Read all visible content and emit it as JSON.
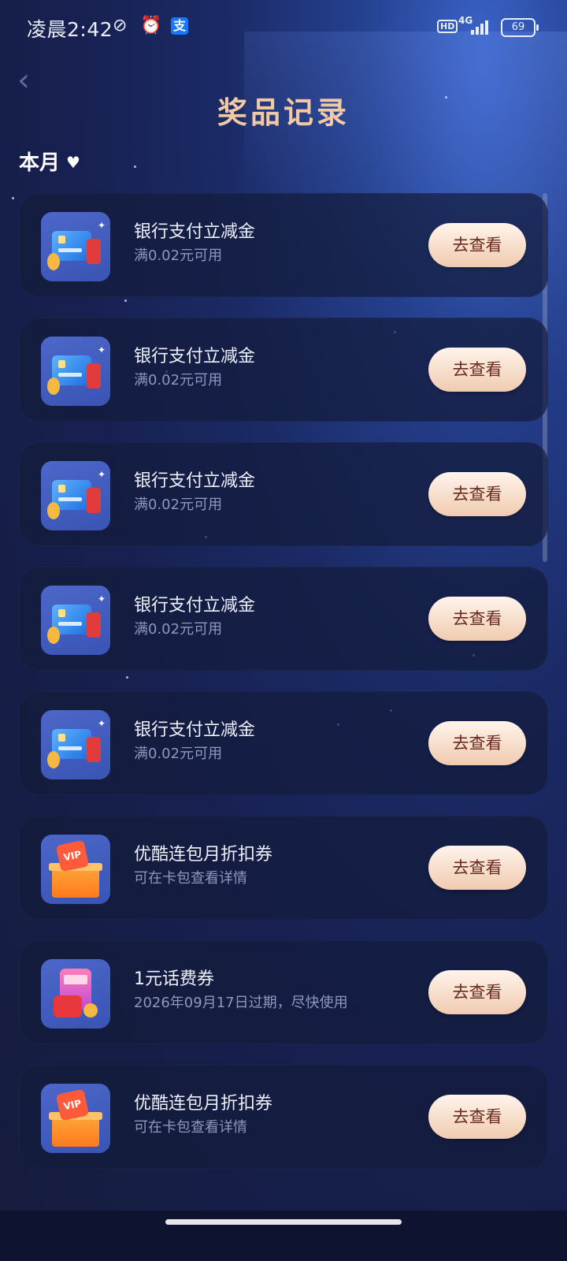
{
  "status_bar": {
    "time": "凌晨2:42",
    "network": "4G",
    "hd": "HD",
    "battery": "69",
    "icons": [
      "do-not-disturb-icon",
      "alarm-icon",
      "alipay-icon",
      "signal-icon",
      "battery-icon"
    ]
  },
  "header": {
    "back_icon": "back-chevron-icon",
    "title": "奖品记录"
  },
  "filter": {
    "label": "本月",
    "icon": "heart-dropdown-icon"
  },
  "prizes": [
    {
      "name": "银行支付立减金",
      "desc": "满0.02元可用",
      "icon": "bank-card-icon",
      "button": "去查看"
    },
    {
      "name": "银行支付立减金",
      "desc": "满0.02元可用",
      "icon": "bank-card-icon",
      "button": "去查看"
    },
    {
      "name": "银行支付立减金",
      "desc": "满0.02元可用",
      "icon": "bank-card-icon",
      "button": "去查看"
    },
    {
      "name": "银行支付立减金",
      "desc": "满0.02元可用",
      "icon": "bank-card-icon",
      "button": "去查看"
    },
    {
      "name": "银行支付立减金",
      "desc": "满0.02元可用",
      "icon": "bank-card-icon",
      "button": "去查看"
    },
    {
      "name": "优酷连包月折扣券",
      "desc": "可在卡包查看详情",
      "icon": "vip-gift-box-icon",
      "button": "去查看"
    },
    {
      "name": "1元话费券",
      "desc": "2026年09月17日过期，尽快使用",
      "icon": "phone-bill-icon",
      "button": "去查看"
    },
    {
      "name": "优酷连包月折扣券",
      "desc": "可在卡包查看详情",
      "icon": "vip-gift-box-icon",
      "button": "去查看"
    }
  ],
  "colors": {
    "title": "#f3c9a4",
    "button_bg": "#f0cbb0",
    "button_text": "#6a2a1e",
    "card_bg": "#141c3c"
  }
}
